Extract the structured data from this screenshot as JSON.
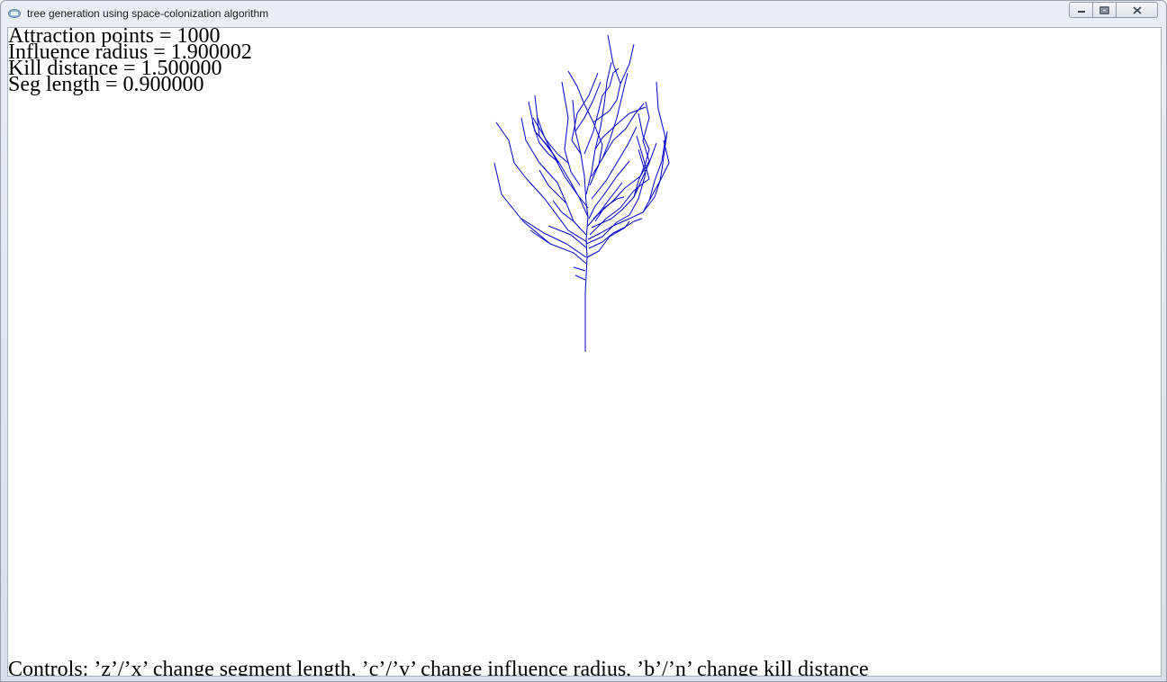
{
  "window": {
    "title": "tree generation using space-colonization algorithm",
    "app_icon": "app-window-icon",
    "buttons": [
      {
        "name": "minimize-icon"
      },
      {
        "name": "maximize-icon"
      },
      {
        "name": "close-icon"
      }
    ]
  },
  "info": {
    "attraction_points": "Attraction points = 1000",
    "influence_radius": "Influence radius = 1.900002",
    "kill_distance": "Kill distance = 1.500000",
    "seg_length": "Seg length = 0.900000"
  },
  "footer": {
    "controls": "Controls: ’z’/’x’ change segment length, ’c’/’v’ change influence radius, ’b’/’n’ change kill distance"
  },
  "colors": {
    "branch": "#0000cc",
    "background": "#ffffff"
  }
}
